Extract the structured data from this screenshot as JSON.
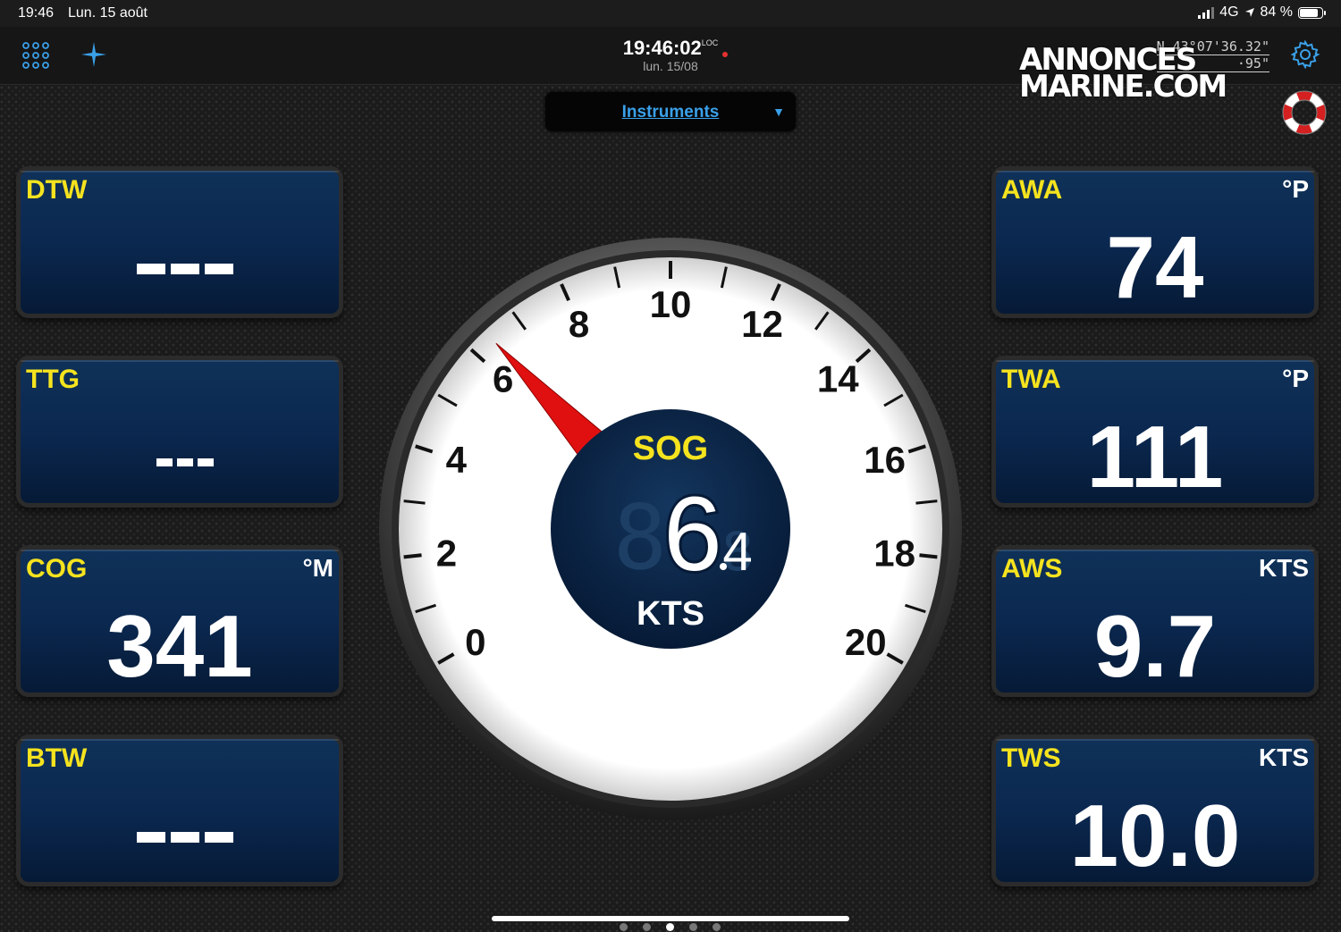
{
  "status_bar": {
    "time": "19:46",
    "date": "Lun. 15 août",
    "network": "4G",
    "battery": "84 %",
    "battery_level": 0.84
  },
  "header": {
    "clock_time": "19:46:02",
    "clock_tag": "LOC",
    "clock_date": "lun. 15/08",
    "coords": {
      "line1": "N  43°07'36.32\"",
      "line2": "·95\""
    }
  },
  "watermark": {
    "line1": "ANNONCES",
    "line2": "MARINE.COM"
  },
  "page_selector": {
    "label": "Instruments"
  },
  "panels": {
    "dtw": {
      "label": "DTW",
      "unit": ""
    },
    "ttg": {
      "label": "TTG",
      "unit": ""
    },
    "cog": {
      "label": "COG",
      "unit": "°M",
      "value": "341"
    },
    "btw": {
      "label": "BTW",
      "unit": ""
    },
    "awa": {
      "label": "AWA",
      "unit": "°P",
      "value": "74"
    },
    "twa": {
      "label": "TWA",
      "unit": "°P",
      "value": "111"
    },
    "aws": {
      "label": "AWS",
      "unit": "KTS",
      "value": "9.7"
    },
    "tws": {
      "label": "TWS",
      "unit": "KTS",
      "value": "10.0"
    }
  },
  "gauge": {
    "title": "SOG",
    "unit": "KTS",
    "value": 6.4,
    "display_int": "6",
    "display_dec": "4",
    "min": 0,
    "max": 20,
    "tick_labels": [
      "0",
      "2",
      "4",
      "6",
      "8",
      "10",
      "12",
      "14",
      "16",
      "18",
      "20"
    ]
  },
  "colors": {
    "label_yellow": "#f5e31e",
    "accent_blue": "#3aa0e8",
    "needle_red": "#e01010",
    "panel_navy": "#0b2850"
  },
  "pager": {
    "dots": 5,
    "active": 2
  }
}
